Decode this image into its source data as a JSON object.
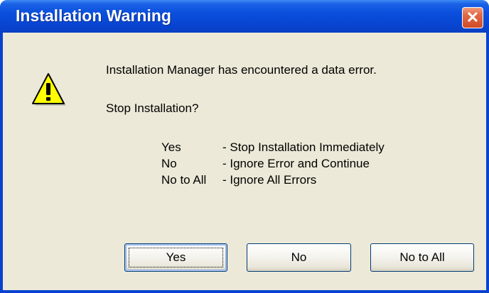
{
  "window": {
    "title": "Installation Warning",
    "close_glyph": "✕",
    "icon": "warning-icon"
  },
  "message": {
    "line1": "Installation Manager has encountered a data error.",
    "line2": "Stop Installation?"
  },
  "options": [
    {
      "key": "Yes",
      "description": "- Stop Installation Immediately"
    },
    {
      "key": "No",
      "description": "- Ignore Error and Continue"
    },
    {
      "key": "No to All",
      "description": "- Ignore All Errors"
    }
  ],
  "buttons": {
    "yes": "Yes",
    "no": "No",
    "no_to_all": "No to All"
  },
  "colors": {
    "title_bar": "#0a4fdc",
    "client_background": "#ece9d8",
    "close_button": "#e06a45",
    "warning_yellow": "#ffff00"
  }
}
